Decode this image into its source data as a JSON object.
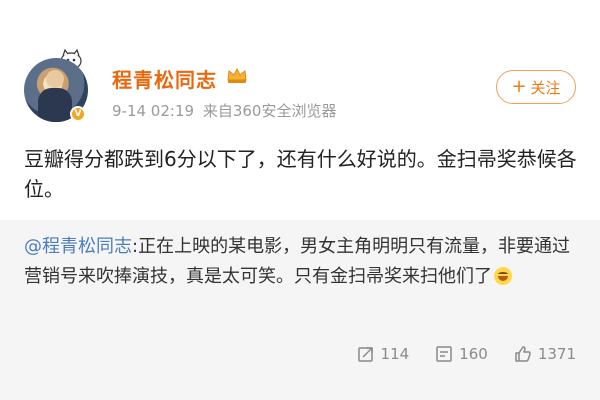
{
  "author": {
    "name": "程青松同志",
    "avatar_badge": "V",
    "vip_icon": "crown-icon"
  },
  "meta": {
    "time": "9-14 02:19",
    "source": "来自360安全浏览器"
  },
  "follow_button": {
    "icon": "+",
    "label": "关注"
  },
  "post": {
    "text": "豆瓣得分都跌到6分以下了，还有什么好说的。金扫帚奖恭候各位。"
  },
  "repost": {
    "mention": "@程青松同志",
    "text": ":正在上映的某电影，男女主角明明只有流量，非要通过营销号来吹捧演技，真是太可笑。只有金扫帚奖来扫他们了",
    "emoji": "grin-emoji"
  },
  "actions": {
    "repost_count": "114",
    "comment_count": "160",
    "like_count": "1371"
  },
  "colors": {
    "username": "#e86a10",
    "mention": "#4a7dbf",
    "follow_border": "#f2a05a",
    "repost_bg": "#f5f5f5"
  }
}
